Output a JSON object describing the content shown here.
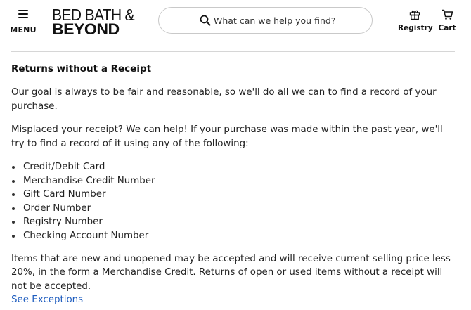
{
  "header": {
    "menu_label": "MENU",
    "logo_line1": "BED BATH &",
    "logo_line2": "BEYOND",
    "search": {
      "placeholder": "What can we help you find?"
    },
    "registry_label": "Registry",
    "cart_label": "Cart"
  },
  "content": {
    "title": "Returns without a Receipt",
    "paragraph1": "Our goal is always to be fair and reasonable, so we'll do all we can to find a record of your purchase.",
    "paragraph2": "Misplaced your receipt? We can help! If your purchase was made within the past year, we'll try to find a record of it using any of the following:",
    "list": [
      "Credit/Debit Card",
      "Merchandise Credit Number",
      "Gift Card Number",
      "Order Number",
      "Registry Number",
      "Checking Account Number"
    ],
    "paragraph3": "Items that are new and unopened may be accepted and will receive current selling price less 20%, in the form a Merchandise Credit. Returns of open or used items without a receipt will not be accepted.",
    "link_label": "See Exceptions"
  },
  "colors": {
    "link": "#1f5dbf",
    "text": "#222222"
  }
}
